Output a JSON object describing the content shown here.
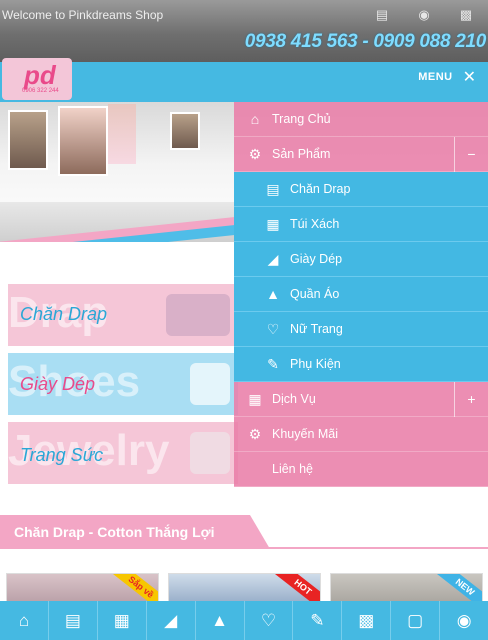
{
  "topbar": {
    "welcome": "Welcome to Pinkdreams Shop",
    "icons": [
      "cart-icon",
      "user-icon",
      "sitemap-icon"
    ],
    "phone": "0938 415 563 - 0909 088 210"
  },
  "header": {
    "logo_mark": "pd",
    "logo_phone": "0906 322 244",
    "menu_label": "MENU"
  },
  "categories": [
    {
      "title": "Chăn Drap",
      "watermark": "Drap"
    },
    {
      "title": "Giày Dép",
      "watermark": "Shoes"
    },
    {
      "title": "Trang Sức",
      "watermark": "Jewelry"
    }
  ],
  "section": {
    "title": "Chăn Drap - Cotton Thắng Lợi"
  },
  "products": [
    {
      "ribbon": "Sắp về",
      "ribbon_color": "#f7c600"
    },
    {
      "ribbon": "HOT",
      "ribbon_color": "#e82323"
    },
    {
      "ribbon": "NEW",
      "ribbon_color": "#3fb3e6"
    }
  ],
  "menu": {
    "items": [
      {
        "label": "Trang Chủ",
        "icon": "home-icon",
        "style": "pink"
      },
      {
        "label": "Sản Phẩm",
        "icon": "cog-icon",
        "style": "pink",
        "toggle": "−"
      },
      {
        "label": "Chăn Drap",
        "icon": "bed-icon",
        "style": "blue"
      },
      {
        "label": "Túi Xách",
        "icon": "bag-icon",
        "style": "blue"
      },
      {
        "label": "Giày Dép",
        "icon": "shoe-icon",
        "style": "blue"
      },
      {
        "label": "Quần Áo",
        "icon": "dress-icon",
        "style": "blue"
      },
      {
        "label": "Nữ Trang",
        "icon": "necklace-icon",
        "style": "blue"
      },
      {
        "label": "Phụ Kiện",
        "icon": "accessory-icon",
        "style": "blue"
      },
      {
        "label": "Dịch Vụ",
        "icon": "service-icon",
        "style": "pink",
        "toggle": "+"
      },
      {
        "label": "Khuyến Mãi",
        "icon": "cog-icon",
        "style": "pink"
      },
      {
        "label": "Liên hệ",
        "icon": "",
        "style": "pink"
      }
    ]
  },
  "bottomnav": [
    "home-icon",
    "bed-icon",
    "bag-icon",
    "shoe-icon",
    "dress-icon",
    "necklace-icon",
    "accessory-icon",
    "gift-icon",
    "tag-icon",
    "scooter-icon"
  ],
  "colors": {
    "pink": "#e97ea9",
    "blue": "#43b8e3",
    "light_pink": "#f5c6d7",
    "light_blue": "#a9def3"
  }
}
